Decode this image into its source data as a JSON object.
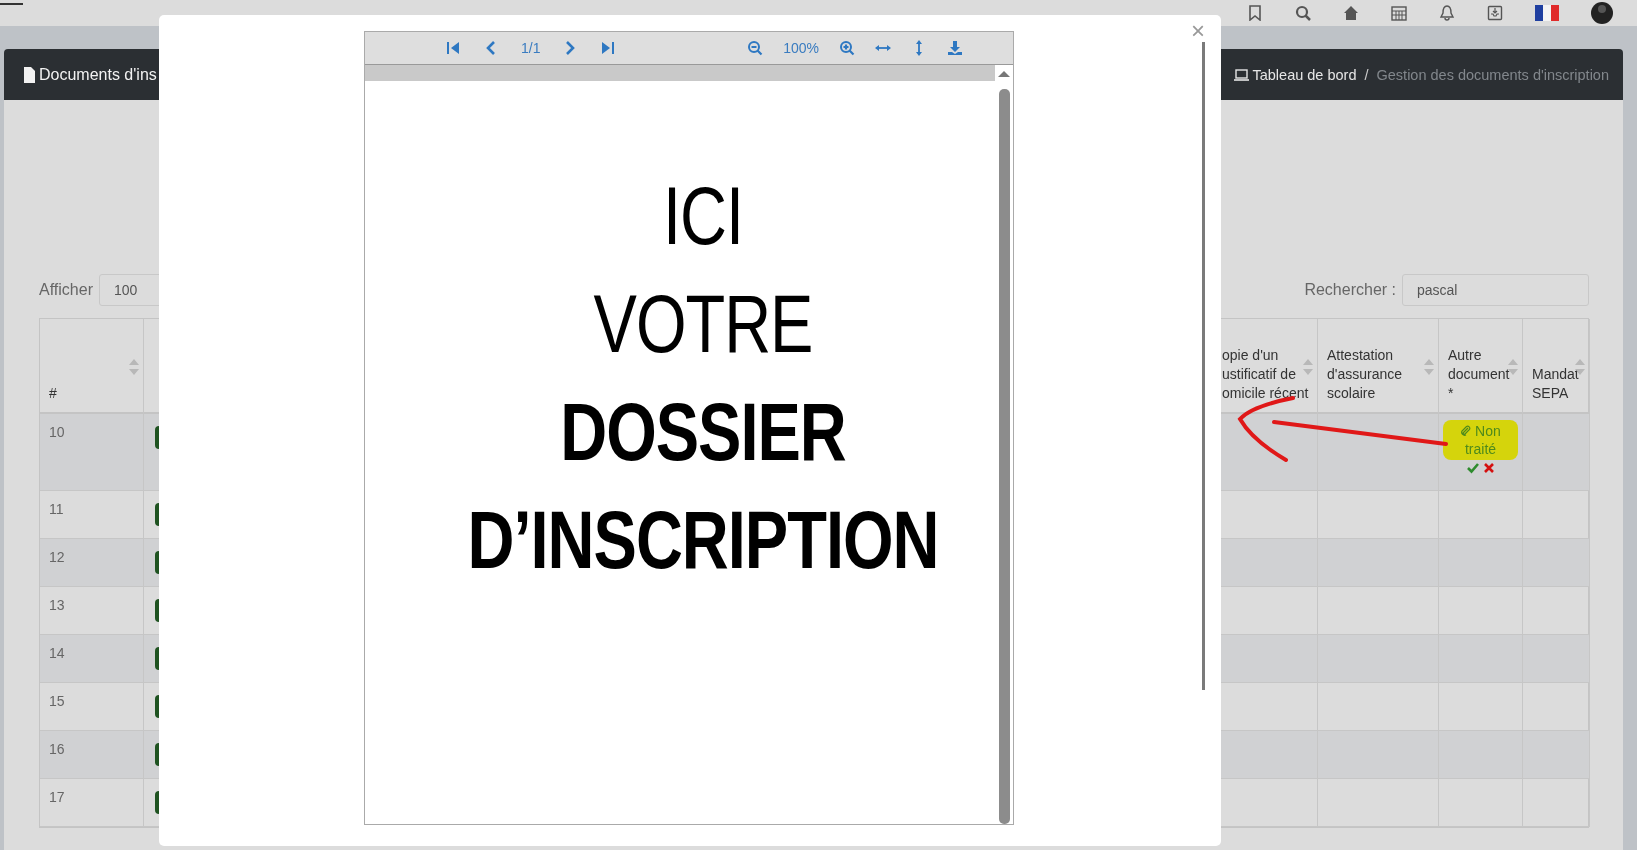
{
  "header": {
    "title": "Documents d'ins",
    "separator": "/",
    "breadcrumb": [
      {
        "label": "Tableau de bord",
        "current": false
      },
      {
        "label": "Gestion des documents d'inscription",
        "current": true
      }
    ]
  },
  "length_control": {
    "label": "Afficher",
    "value": "100"
  },
  "search": {
    "label": "Rechercher :",
    "value": "pascal"
  },
  "table": {
    "columns": [
      {
        "label": "#",
        "sortable": true
      },
      {
        "label": "opie d'un\nustificatif de\nomicile récent",
        "sortable": true
      },
      {
        "label": "Attestation d'assurance scolaire",
        "sortable": true
      },
      {
        "label": "Autre document *",
        "sortable": true
      },
      {
        "label": "Mandat SEPA",
        "sortable": true
      }
    ],
    "rows": [
      {
        "number": "10",
        "autre_document": {
          "label": "Non traité",
          "highlighted": true
        }
      },
      {
        "number": "11"
      },
      {
        "number": "12"
      },
      {
        "number": "13"
      },
      {
        "number": "14"
      },
      {
        "number": "15"
      },
      {
        "number": "16"
      },
      {
        "number": "17"
      }
    ]
  },
  "modal": {
    "close": "×",
    "viewer": {
      "page": "1/1",
      "zoom": "100%"
    },
    "document_lines": [
      {
        "text": "ICI",
        "bold": false
      },
      {
        "text": "VOTRE",
        "bold": false
      },
      {
        "text": "DOSSIER",
        "bold": true
      },
      {
        "text": "D’INSCRIPTION",
        "bold": true
      }
    ]
  }
}
